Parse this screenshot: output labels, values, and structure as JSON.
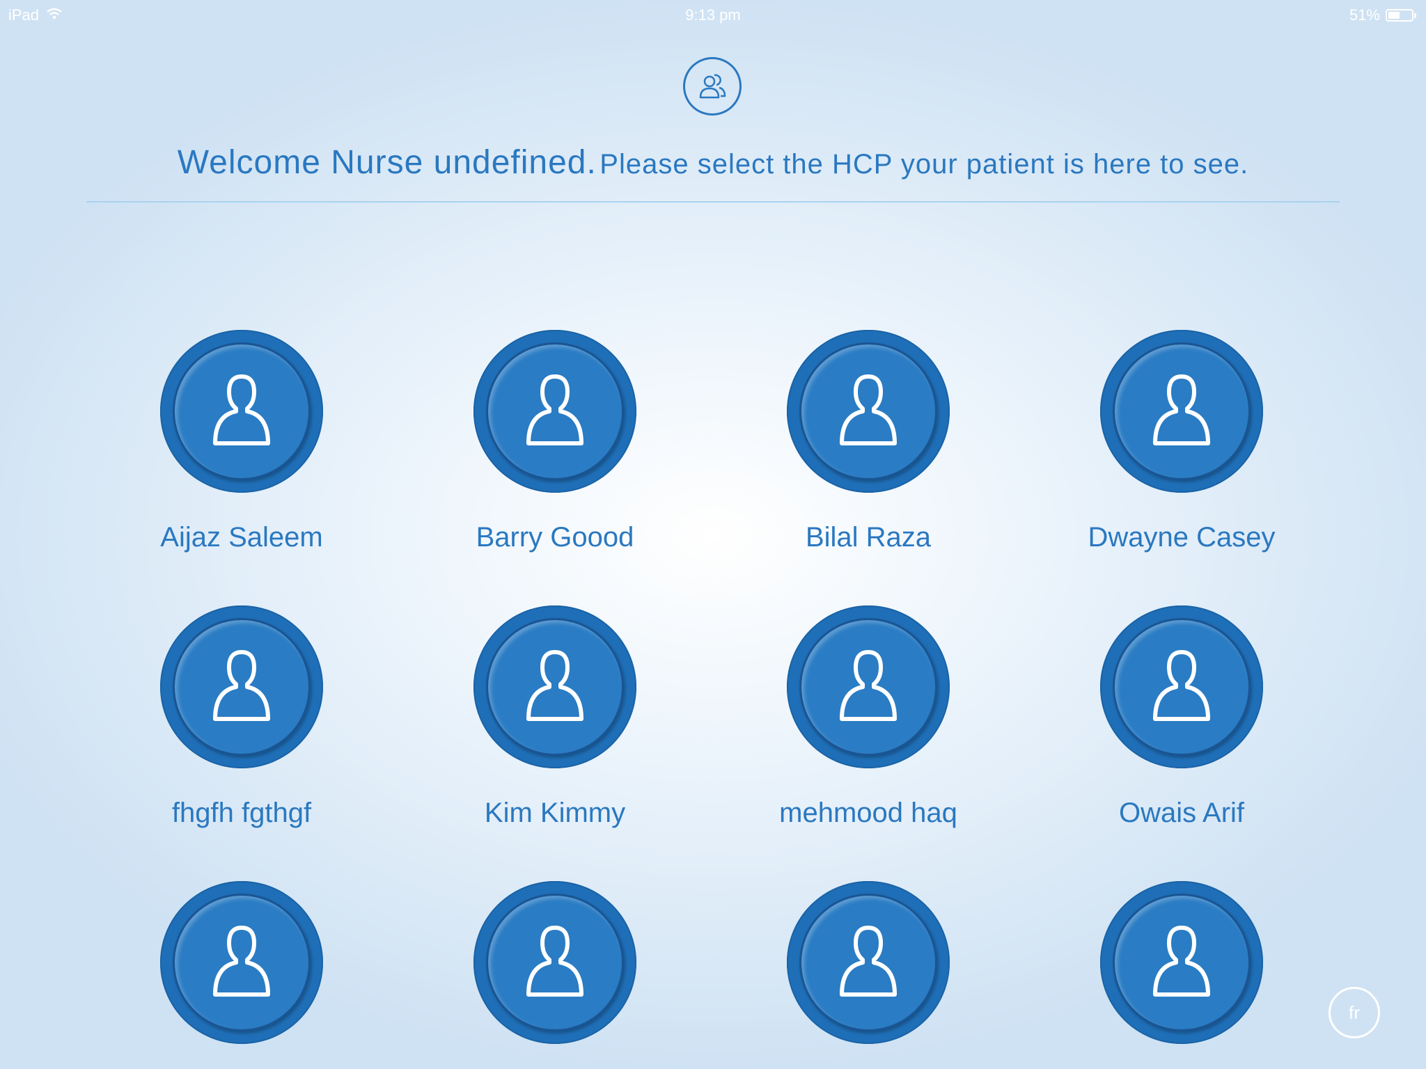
{
  "status_bar": {
    "device": "iPad",
    "time": "9:13 pm",
    "battery_text": "51%",
    "battery_level": 0.51
  },
  "header": {
    "icon": "users-icon",
    "welcome_strong": "Welcome Nurse undefined.",
    "welcome_sub": "Please select the HCP your patient is here to see."
  },
  "hcps": [
    {
      "name": "Aijaz Saleem"
    },
    {
      "name": "Barry Goood"
    },
    {
      "name": "Bilal Raza"
    },
    {
      "name": "Dwayne Casey"
    },
    {
      "name": "fhgfh fgthgf"
    },
    {
      "name": "Kim Kimmy"
    },
    {
      "name": "mehmood haq"
    },
    {
      "name": "Owais Arif"
    },
    {
      "name": ""
    },
    {
      "name": ""
    },
    {
      "name": ""
    },
    {
      "name": ""
    }
  ],
  "language_button": {
    "label": "fr"
  },
  "colors": {
    "accent": "#2a78c0",
    "avatar_fill": "#2a7cc4",
    "avatar_ring": "#1f6fb8"
  }
}
